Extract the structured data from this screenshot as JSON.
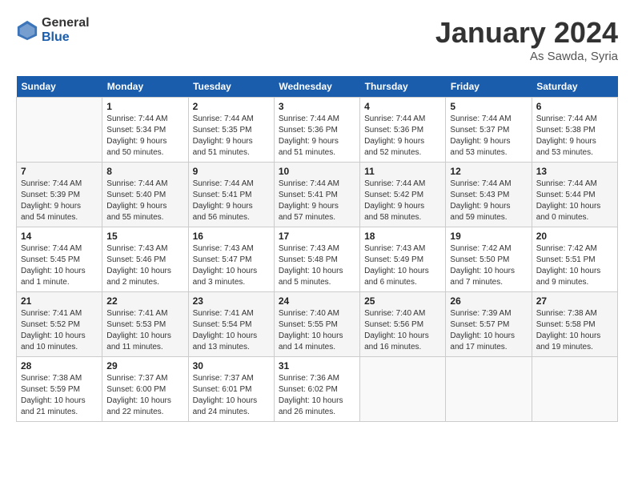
{
  "logo": {
    "general": "General",
    "blue": "Blue"
  },
  "title": "January 2024",
  "location": "As Sawda, Syria",
  "days_header": [
    "Sunday",
    "Monday",
    "Tuesday",
    "Wednesday",
    "Thursday",
    "Friday",
    "Saturday"
  ],
  "weeks": [
    [
      {
        "day": "",
        "info": ""
      },
      {
        "day": "1",
        "info": "Sunrise: 7:44 AM\nSunset: 5:34 PM\nDaylight: 9 hours\nand 50 minutes."
      },
      {
        "day": "2",
        "info": "Sunrise: 7:44 AM\nSunset: 5:35 PM\nDaylight: 9 hours\nand 51 minutes."
      },
      {
        "day": "3",
        "info": "Sunrise: 7:44 AM\nSunset: 5:36 PM\nDaylight: 9 hours\nand 51 minutes."
      },
      {
        "day": "4",
        "info": "Sunrise: 7:44 AM\nSunset: 5:36 PM\nDaylight: 9 hours\nand 52 minutes."
      },
      {
        "day": "5",
        "info": "Sunrise: 7:44 AM\nSunset: 5:37 PM\nDaylight: 9 hours\nand 53 minutes."
      },
      {
        "day": "6",
        "info": "Sunrise: 7:44 AM\nSunset: 5:38 PM\nDaylight: 9 hours\nand 53 minutes."
      }
    ],
    [
      {
        "day": "7",
        "info": "Sunrise: 7:44 AM\nSunset: 5:39 PM\nDaylight: 9 hours\nand 54 minutes."
      },
      {
        "day": "8",
        "info": "Sunrise: 7:44 AM\nSunset: 5:40 PM\nDaylight: 9 hours\nand 55 minutes."
      },
      {
        "day": "9",
        "info": "Sunrise: 7:44 AM\nSunset: 5:41 PM\nDaylight: 9 hours\nand 56 minutes."
      },
      {
        "day": "10",
        "info": "Sunrise: 7:44 AM\nSunset: 5:41 PM\nDaylight: 9 hours\nand 57 minutes."
      },
      {
        "day": "11",
        "info": "Sunrise: 7:44 AM\nSunset: 5:42 PM\nDaylight: 9 hours\nand 58 minutes."
      },
      {
        "day": "12",
        "info": "Sunrise: 7:44 AM\nSunset: 5:43 PM\nDaylight: 9 hours\nand 59 minutes."
      },
      {
        "day": "13",
        "info": "Sunrise: 7:44 AM\nSunset: 5:44 PM\nDaylight: 10 hours\nand 0 minutes."
      }
    ],
    [
      {
        "day": "14",
        "info": "Sunrise: 7:44 AM\nSunset: 5:45 PM\nDaylight: 10 hours\nand 1 minute."
      },
      {
        "day": "15",
        "info": "Sunrise: 7:43 AM\nSunset: 5:46 PM\nDaylight: 10 hours\nand 2 minutes."
      },
      {
        "day": "16",
        "info": "Sunrise: 7:43 AM\nSunset: 5:47 PM\nDaylight: 10 hours\nand 3 minutes."
      },
      {
        "day": "17",
        "info": "Sunrise: 7:43 AM\nSunset: 5:48 PM\nDaylight: 10 hours\nand 5 minutes."
      },
      {
        "day": "18",
        "info": "Sunrise: 7:43 AM\nSunset: 5:49 PM\nDaylight: 10 hours\nand 6 minutes."
      },
      {
        "day": "19",
        "info": "Sunrise: 7:42 AM\nSunset: 5:50 PM\nDaylight: 10 hours\nand 7 minutes."
      },
      {
        "day": "20",
        "info": "Sunrise: 7:42 AM\nSunset: 5:51 PM\nDaylight: 10 hours\nand 9 minutes."
      }
    ],
    [
      {
        "day": "21",
        "info": "Sunrise: 7:41 AM\nSunset: 5:52 PM\nDaylight: 10 hours\nand 10 minutes."
      },
      {
        "day": "22",
        "info": "Sunrise: 7:41 AM\nSunset: 5:53 PM\nDaylight: 10 hours\nand 11 minutes."
      },
      {
        "day": "23",
        "info": "Sunrise: 7:41 AM\nSunset: 5:54 PM\nDaylight: 10 hours\nand 13 minutes."
      },
      {
        "day": "24",
        "info": "Sunrise: 7:40 AM\nSunset: 5:55 PM\nDaylight: 10 hours\nand 14 minutes."
      },
      {
        "day": "25",
        "info": "Sunrise: 7:40 AM\nSunset: 5:56 PM\nDaylight: 10 hours\nand 16 minutes."
      },
      {
        "day": "26",
        "info": "Sunrise: 7:39 AM\nSunset: 5:57 PM\nDaylight: 10 hours\nand 17 minutes."
      },
      {
        "day": "27",
        "info": "Sunrise: 7:38 AM\nSunset: 5:58 PM\nDaylight: 10 hours\nand 19 minutes."
      }
    ],
    [
      {
        "day": "28",
        "info": "Sunrise: 7:38 AM\nSunset: 5:59 PM\nDaylight: 10 hours\nand 21 minutes."
      },
      {
        "day": "29",
        "info": "Sunrise: 7:37 AM\nSunset: 6:00 PM\nDaylight: 10 hours\nand 22 minutes."
      },
      {
        "day": "30",
        "info": "Sunrise: 7:37 AM\nSunset: 6:01 PM\nDaylight: 10 hours\nand 24 minutes."
      },
      {
        "day": "31",
        "info": "Sunrise: 7:36 AM\nSunset: 6:02 PM\nDaylight: 10 hours\nand 26 minutes."
      },
      {
        "day": "",
        "info": ""
      },
      {
        "day": "",
        "info": ""
      },
      {
        "day": "",
        "info": ""
      }
    ]
  ]
}
